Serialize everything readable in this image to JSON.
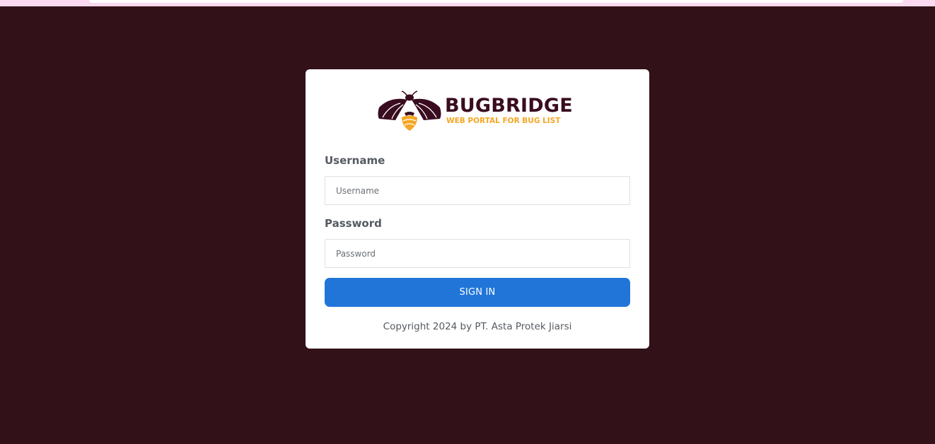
{
  "brand": {
    "name": "BUGBRIDGE",
    "tagline": "WEB PORTAL FOR BUG LIST",
    "colors": {
      "primary": "#3a0c1f",
      "accent": "#f5a623"
    },
    "logo_icon": "firefly-bug-icon"
  },
  "form": {
    "username_label": "Username",
    "username_placeholder": "Username",
    "username_value": "",
    "password_label": "Password",
    "password_placeholder": "Password",
    "password_value": "",
    "submit_label": "SIGN IN"
  },
  "footer": {
    "copyright": "Copyright 2024 by PT. Asta Protek Jiarsi"
  },
  "theme": {
    "page_background": "#331118",
    "card_background": "#ffffff",
    "button_color": "#2175d9"
  }
}
